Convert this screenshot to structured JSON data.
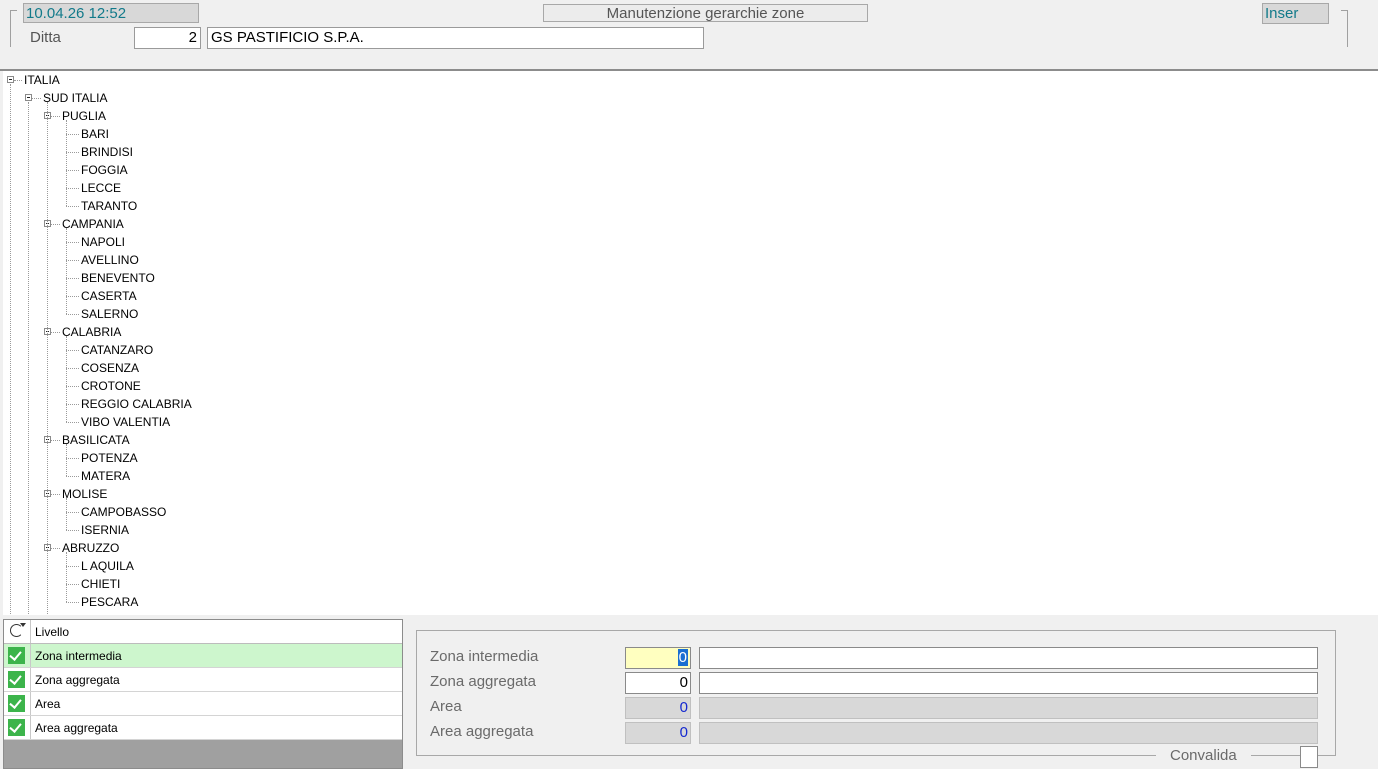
{
  "header": {
    "datetime": "10.04.26 12:52",
    "title": "Manutenzione gerarchie zone",
    "mode": "Inser",
    "ditta_label": "Ditta",
    "ditta_code": "2",
    "ditta_name": "GS PASTIFICIO S.P.A."
  },
  "tree": {
    "root": "ITALIA",
    "region": "SUD ITALIA",
    "groups": [
      {
        "name": "PUGLIA",
        "children": [
          "BARI",
          "BRINDISI",
          "FOGGIA",
          "LECCE",
          "TARANTO"
        ]
      },
      {
        "name": "CAMPANIA",
        "children": [
          "NAPOLI",
          "AVELLINO",
          "BENEVENTO",
          "CASERTA",
          "SALERNO"
        ]
      },
      {
        "name": "CALABRIA",
        "children": [
          "CATANZARO",
          "COSENZA",
          "CROTONE",
          "REGGIO CALABRIA",
          "VIBO VALENTIA"
        ]
      },
      {
        "name": "BASILICATA",
        "children": [
          "POTENZA",
          "MATERA"
        ]
      },
      {
        "name": "MOLISE",
        "children": [
          "CAMPOBASSO",
          "ISERNIA"
        ]
      },
      {
        "name": "ABRUZZO",
        "children": [
          "L AQUILA",
          "CHIETI",
          "PESCARA"
        ]
      }
    ]
  },
  "levels_grid": {
    "header": "Livello",
    "rows": [
      {
        "label": "Zona intermedia",
        "checked": true,
        "selected": true
      },
      {
        "label": "Zona aggregata",
        "checked": true,
        "selected": false
      },
      {
        "label": "Area",
        "checked": true,
        "selected": false
      },
      {
        "label": "Area aggregata",
        "checked": true,
        "selected": false
      }
    ]
  },
  "form": {
    "zona_intermedia": {
      "label": "Zona intermedia",
      "value": "0",
      "desc": ""
    },
    "zona_aggregata": {
      "label": "Zona aggregata",
      "value": "0",
      "desc": ""
    },
    "area": {
      "label": "Area",
      "value": "0",
      "desc": ""
    },
    "area_aggregata": {
      "label": "Area aggregata",
      "value": "0",
      "desc": ""
    },
    "convalida_label": "Convalida"
  },
  "colors": {
    "accent_teal": "#127a8a",
    "check_green": "#3cb44b",
    "selected_row": "#cdf6cd",
    "active_field": "#ffffc0"
  },
  "icons": {
    "refresh": "refresh-icon",
    "check": "check-icon",
    "expander": "minus-box-icon"
  }
}
